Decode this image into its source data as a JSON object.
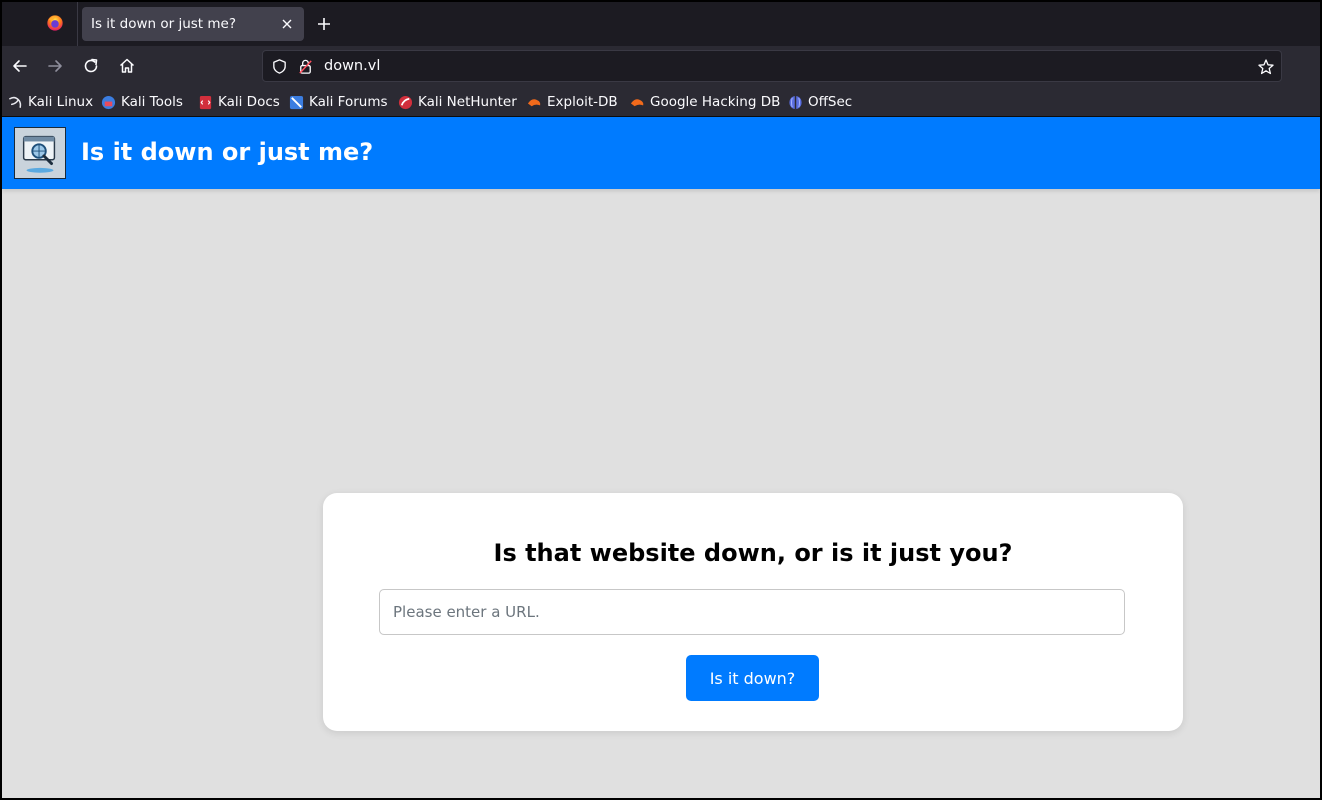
{
  "browser": {
    "tab": {
      "title": "Is it down or just me?"
    },
    "urlbar": {
      "url": "down.vl"
    },
    "bookmarks": [
      {
        "label": "Kali Linux",
        "icon": "kali-dragon-icon"
      },
      {
        "label": "Kali Tools",
        "icon": "kali-tools-icon"
      },
      {
        "label": "Kali Docs",
        "icon": "kali-docs-icon"
      },
      {
        "label": "Kali Forums",
        "icon": "kali-forums-icon"
      },
      {
        "label": "Kali NetHunter",
        "icon": "kali-nethunter-icon"
      },
      {
        "label": "Exploit-DB",
        "icon": "exploit-db-icon"
      },
      {
        "label": "Google Hacking DB",
        "icon": "google-hacking-db-icon"
      },
      {
        "label": "OffSec",
        "icon": "offsec-icon"
      }
    ]
  },
  "site": {
    "header_title": "Is it down or just me?",
    "card_heading": "Is that website down, or is it just you?",
    "url_placeholder": "Please enter a URL.",
    "submit_label": "Is it down?"
  },
  "colors": {
    "brand_blue": "#007bff",
    "page_bg": "#e0e0e0",
    "browser_dark": "#1c1b22"
  }
}
